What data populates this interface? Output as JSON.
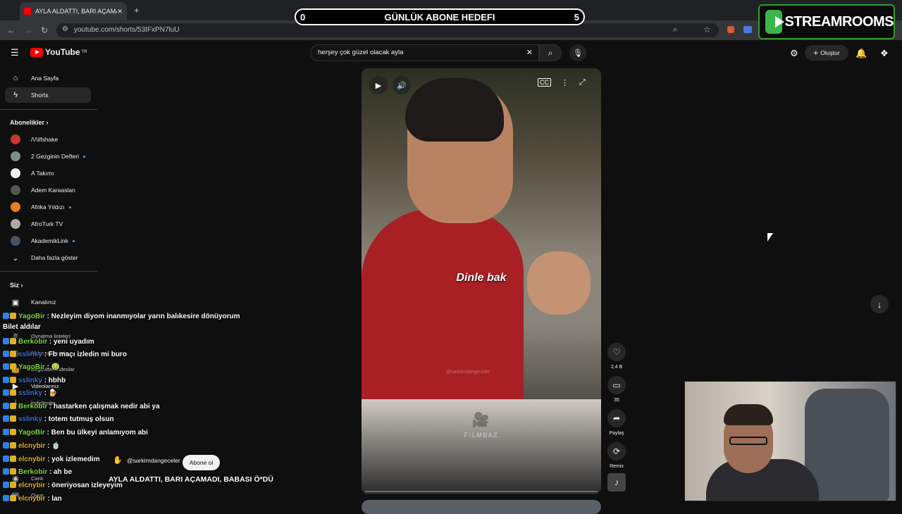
{
  "browser": {
    "tab_title": "AYLA ALDATTI, BARI AÇAMADI,",
    "url": "youtube.com/shorts/53IFxPN7luU",
    "new_tab": "+",
    "close_tab": "✕"
  },
  "overlay": {
    "goal_label": "GÜNLÜK ABONE HEDEFI",
    "goal_current": "0",
    "goal_target": "5",
    "brand": "STREAMROOMS"
  },
  "youtube": {
    "logo_text": "YouTube",
    "logo_region": "TR",
    "search_value": "herşey çok güzel olacak ayla",
    "create_label": "Oluştur"
  },
  "sidebar": {
    "main": [
      {
        "label": "Ana Sayfa",
        "icon": "home-icon"
      },
      {
        "label": "Shorts",
        "icon": "shorts-icon"
      }
    ],
    "subs_heading": "Abonelikler",
    "subs": [
      {
        "label": "/\\/\\ilfshake",
        "color": "#c0392b",
        "dot": false
      },
      {
        "label": "2 Gezginin Defteri",
        "color": "#7f8c8d",
        "dot": true
      },
      {
        "label": "A Takımı",
        "color": "#ecf0f1",
        "dot": false
      },
      {
        "label": "Adem Karaaslan",
        "color": "#555555",
        "dot": false
      },
      {
        "label": "Afrika Yıldızı",
        "color": "#e67e22",
        "dot": true
      },
      {
        "label": "AfroTurk TV",
        "color": "#aaaaaa",
        "dot": false
      },
      {
        "label": "AkademikLink",
        "color": "#445566",
        "dot": true
      }
    ],
    "show_more": "Daha fazla göster",
    "you_heading": "Siz",
    "you": [
      {
        "label": "Kanalınız"
      },
      {
        "label": "Oynatma listeleri"
      },
      {
        "label": "Daha sonra izle"
      },
      {
        "label": "Beğenilen videolar"
      },
      {
        "label": "Videolarınız"
      },
      {
        "label": "İndirilenler"
      }
    ],
    "bottom": [
      {
        "label": "Canlı"
      },
      {
        "label": "Oyun"
      }
    ]
  },
  "short": {
    "caption": "Dinle bak",
    "watermark": "@sarkimdangeceler",
    "filmbaz": "FILMBAZ",
    "channel": "@sarkimdangeceler",
    "subscribe": "Abone ol",
    "title": "AYLA ALDATTI, BARI AÇAMADI, BABASI Ö*DÜ",
    "likes": "2,4 B",
    "comments": "35",
    "share": "Paylaş",
    "remix": "Remix"
  },
  "chat": [
    {
      "user": "YagoBir",
      "color": "#7ad63c",
      "text": ": Nezleyim diyom inanmıyolar yarın balıkesire dönüyorum"
    },
    {
      "user": "",
      "color": "#ffffff",
      "text": "Bilet aldılar"
    },
    {
      "user": "Berkobir",
      "color": "#7ad63c",
      "text": ": yeni uyadım"
    },
    {
      "user": "sslinky",
      "color": "#3b6fd8",
      "text": ": Fb maçı izledin mi buro"
    },
    {
      "user": "YagoBir",
      "color": "#7ad63c",
      "text": ": 🤢"
    },
    {
      "user": "sslinky",
      "color": "#3b6fd8",
      "text": ": hbhb"
    },
    {
      "user": "sslinky",
      "color": "#3b6fd8",
      "text": ": 🍺"
    },
    {
      "user": "Berkobir",
      "color": "#7ad63c",
      "text": ": hastarken çalışmak nedir abi ya"
    },
    {
      "user": "sslinky",
      "color": "#3b6fd8",
      "text": ": totem tutmuş olsun"
    },
    {
      "user": "YagoBir",
      "color": "#7ad63c",
      "text": ": Ben bu ülkeyi anlamıyom abi"
    },
    {
      "user": "elcnybir",
      "color": "#e0b020",
      "text": ": 🍵"
    },
    {
      "user": "elcnybir",
      "color": "#e0b020",
      "text": ": yok izlemedim"
    },
    {
      "user": "Berkobir",
      "color": "#7ad63c",
      "text": ": ah be"
    },
    {
      "user": "elcnybir",
      "color": "#e0b020",
      "text": ": öneriyosan izleyeyim"
    },
    {
      "user": "elcnybir",
      "color": "#e0b020",
      "text": ": lan"
    }
  ]
}
